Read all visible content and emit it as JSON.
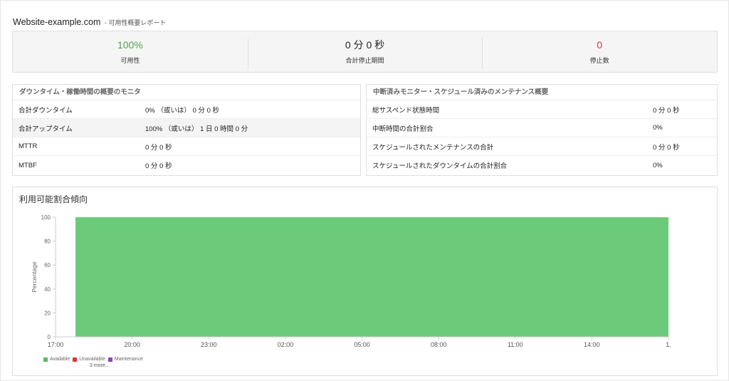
{
  "header": {
    "site": "Website-example.com",
    "subtitle": "- 可用性概要レポート"
  },
  "summary": [
    {
      "value": "100%",
      "label": "可用性",
      "color": "#4aa64a"
    },
    {
      "value": "0 分 0 秒",
      "label": "合計停止期間",
      "color": "#222222"
    },
    {
      "value": "0",
      "label": "停止数",
      "color": "#e3322f"
    }
  ],
  "downtime_panel": {
    "title": "ダウンタイム・稼働時間の概要のモニタ",
    "rows": [
      {
        "label": "合計ダウンタイム",
        "value": "0%  （或いは） 0 分 0 秒"
      },
      {
        "label": "合計アップタイム",
        "value": "100%  （或いは） 1 日 0 時間 0 分"
      },
      {
        "label": "MTTR",
        "value": "0 分 0 秒"
      },
      {
        "label": "MTBF",
        "value": "0 分 0 秒"
      }
    ]
  },
  "maintenance_panel": {
    "title": "中断済みモニター・スケジュール済みのメンテナンス概要",
    "rows": [
      {
        "label": "総サスペンド状態時間",
        "value": "0 分 0 秒"
      },
      {
        "label": "中断時間の合計割合",
        "value": "0%"
      },
      {
        "label": "スケジュールされたメンテナンスの合計",
        "value": "0 分 0 秒"
      },
      {
        "label": "スケジュールされたダウンタイムの合計割合",
        "value": "0%"
      }
    ]
  },
  "chart_section": {
    "title": "利用可能割合傾向",
    "more": "3 more..."
  },
  "chart_data": {
    "type": "area",
    "ylabel": "Percentage",
    "ylim": [
      0,
      100
    ],
    "yticks": [
      0,
      20,
      40,
      60,
      80,
      100
    ],
    "x": [
      "17:00",
      "20:00",
      "23:00",
      "02:00",
      "05:00",
      "08:00",
      "11:00",
      "14:00",
      "1."
    ],
    "series": [
      {
        "name": "Available",
        "color": "#6ccb7b",
        "values": [
          100,
          100,
          100,
          100,
          100,
          100,
          100,
          100,
          100
        ]
      }
    ],
    "legend": [
      {
        "name": "Available",
        "color": "#5cb85c"
      },
      {
        "name": "Unavailable",
        "color": "#e3322f"
      },
      {
        "name": "Maintenance",
        "color": "#8e44ad"
      }
    ],
    "legend_position": "bottom-left",
    "grid": false
  }
}
